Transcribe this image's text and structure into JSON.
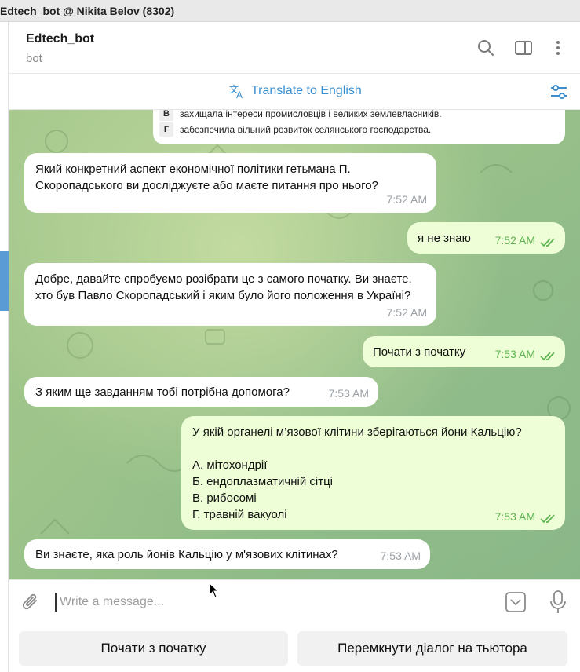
{
  "window": {
    "title": "Edtech_bot @ Nikita Belov (8302)"
  },
  "header": {
    "name": "Edtech_bot",
    "status": "bot",
    "icons": [
      "search-icon",
      "sidebar-toggle-icon",
      "more-vert-icon"
    ]
  },
  "translate_bar": {
    "label": "Translate to English",
    "icon": "translate-icon",
    "settings_icon": "translate-settings-icon"
  },
  "quiz_partial": {
    "rows": [
      {
        "letter": "В",
        "text": "захищала інтереси промисловців і великих землевласників."
      },
      {
        "letter": "Г",
        "text": "забезпечила вільний розвиток селянського господарства."
      }
    ]
  },
  "messages": [
    {
      "dir": "in",
      "text": "Який конкретний аспект економічної політики гетьмана П. Скоропадського ви досліджуєте або маєте питання про нього?",
      "time": "7:52 AM"
    },
    {
      "dir": "out",
      "text": "я не знаю",
      "time": "7:52 AM"
    },
    {
      "dir": "in",
      "text": "Добре, давайте спробуємо розібрати це з самого початку. Ви знаєте, хто був Павло Скоропадський і яким було його положення в Україні?",
      "time": "7:52 AM"
    },
    {
      "dir": "out",
      "text": "Почати з початку",
      "time": "7:53 AM"
    },
    {
      "dir": "in",
      "text": "З яким ще завданням тобі потрібна допомога?",
      "time": "7:53 AM"
    },
    {
      "dir": "out",
      "text": "У якій органелі м’язової клітини зберігаються йони Кальцію?\n\nА. мітохондрії\nБ. ендоплазматичній сітці\nВ. рибосомі\nГ. травній вакуолі",
      "time": "7:53 AM"
    },
    {
      "dir": "in",
      "text": "Ви знаєте, яка роль йонів Кальцію у м'язових клітинах?",
      "time": "7:53 AM"
    }
  ],
  "composer": {
    "placeholder": "Write a message...",
    "icons": [
      "attach-icon",
      "keyboard-toggle-icon",
      "microphone-icon"
    ]
  },
  "keyboard": {
    "buttons": [
      "Почати з початку",
      "Перемкнути діалог на тьютора"
    ]
  },
  "colors": {
    "accent": "#3a8fd0",
    "outgoing_bubble": "#eefed6",
    "incoming_bubble": "#ffffff",
    "read_ticks": "#5fb353"
  }
}
